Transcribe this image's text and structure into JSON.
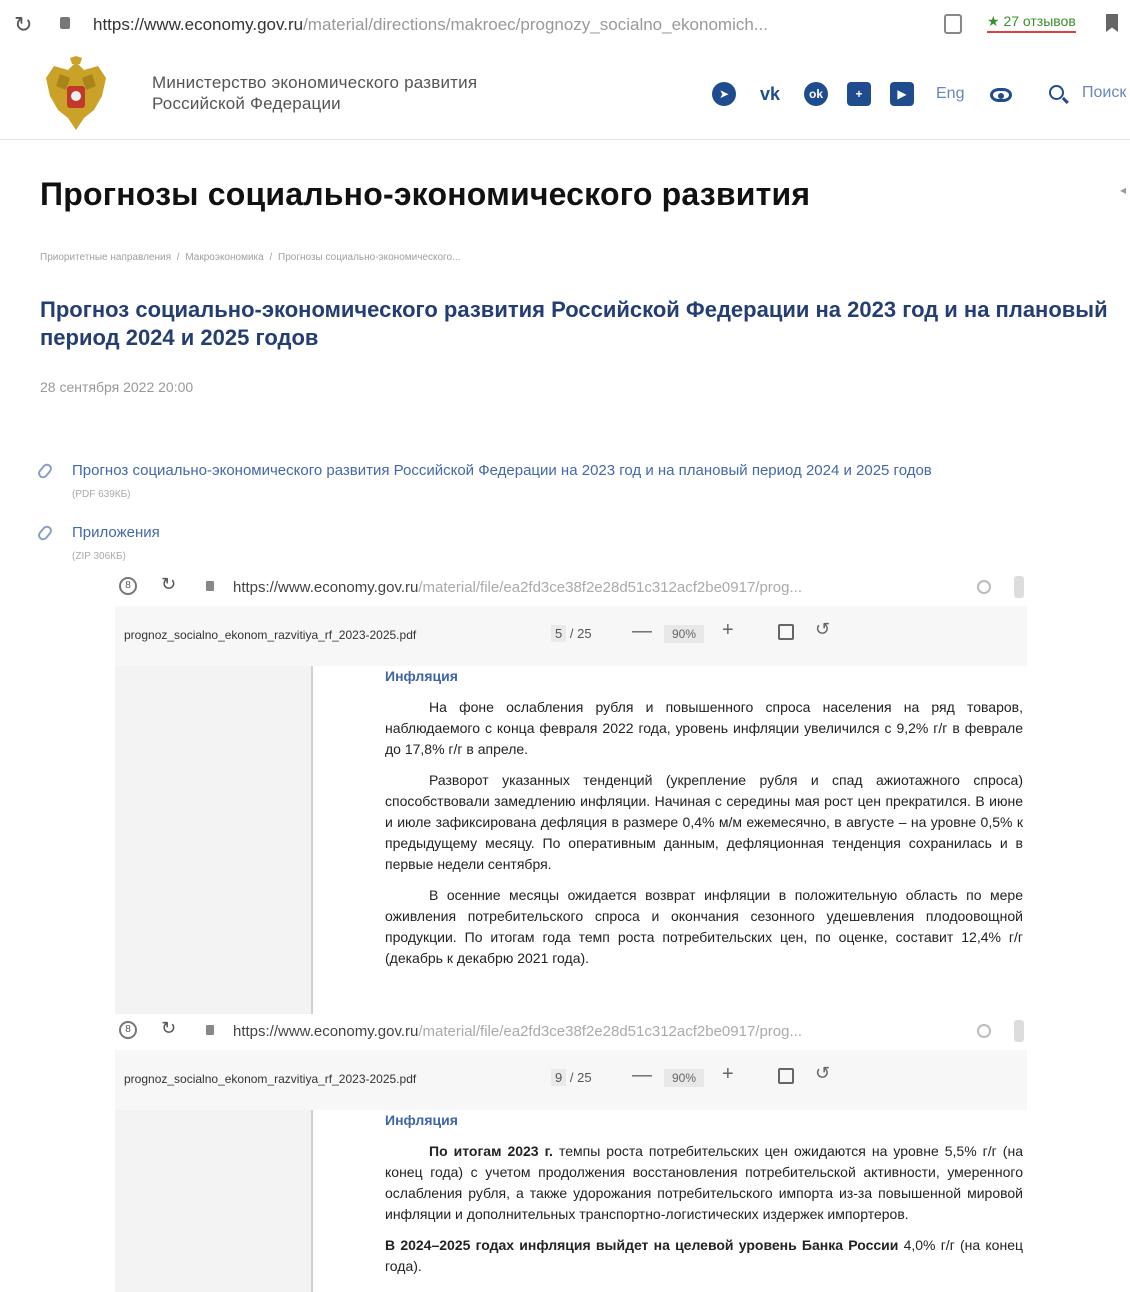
{
  "browser": {
    "url_host": "https://www.economy.gov.ru",
    "url_path": "/material/directions/makroec/prognozy_socialno_ekonomich...",
    "reviews": "★ 27 отзывов"
  },
  "header": {
    "ministry_line1": "Министерство экономического развития",
    "ministry_line2": "Российской Федерации",
    "social": [
      "telegram-icon",
      "vk-icon",
      "odnoklassniki-icon",
      "plus-icon",
      "youtube-icon"
    ],
    "lang": "Eng",
    "search_label": "Поиск"
  },
  "page": {
    "title": "Прогнозы социально-экономического развития",
    "breadcrumb": [
      "Приоритетные направления",
      "/",
      "Макроэкономика",
      "/",
      "Прогнозы социально-экономического..."
    ],
    "doc_title": "Прогноз социально-экономического развития Российской Федерации на 2023 год и на плановый период 2024 и 2025 годов",
    "date": "28 сентября 2022 20:00",
    "attachments": [
      {
        "name": "Прогноз социально-экономического развития Российской Федерации на 2023 год и на плановый период 2024 и 2025 годов",
        "meta": "(PDF 639КБ)"
      },
      {
        "name": "Приложения",
        "meta": "(ZIP 306КБ)"
      }
    ]
  },
  "pdf1": {
    "url_host": "https://www.economy.gov.ru",
    "url_path": "/material/file/ea2fd3ce38f2e28d51c312acf2be0917/prog...",
    "filename": "prognoz_socialno_ekonom_razvitiya_rf_2023-2025.pdf",
    "page_current": "5",
    "page_total": "/ 25",
    "zoom": "90%",
    "heading": "Инфляция",
    "paragraphs": [
      "На фоне ослабления рубля и повышенного спроса населения на ряд товаров, наблюдаемого с конца февраля 2022 года, уровень инфляции увеличился с 9,2% г/г в феврале до 17,8% г/г в апреле.",
      "Разворот указанных тенденций (укрепление рубля и спад ажиотажного спроса) способствовали замедлению инфляции. Начиная с середины мая рост цен прекратился. В июне и июле зафиксирована дефляция в размере 0,4% м/м ежемесячно, в августе – на уровне 0,5% к предыдущему месяцу. По оперативным данным, дефляционная тенденция сохранилась и в первые недели сентября.",
      "В осенние месяцы ожидается возврат инфляции в положительную область по мере оживления потребительского спроса и окончания сезонного удешевления плодоовощной продукции. По итогам года темп роста потребительских цен, по оценке, составит 12,4% г/г (декабрь к декабрю 2021 года)."
    ]
  },
  "pdf2": {
    "url_host": "https://www.economy.gov.ru",
    "url_path": "/material/file/ea2fd3ce38f2e28d51c312acf2be0917/prog...",
    "filename": "prognoz_socialno_ekonom_razvitiya_rf_2023-2025.pdf",
    "page_current": "9",
    "page_total": "/ 25",
    "zoom": "90%",
    "heading": "Инфляция",
    "p1_bold": "По итогам 2023 г.",
    "p1_rest": " темпы роста потребительских цен ожидаются на уровне 5,5% г/г (на конец года) с учетом продолжения восстановления потребительской активности, умеренного ослабления рубля, а также удорожания потребительского импорта из-за повышенной мировой инфляции и дополнительных транспортно-логистических издержек импортеров.",
    "p2_bold": "В 2024–2025 годах инфляция выйдет на целевой уровень Банка России",
    "p2_rest": " 4,0% г/г (на конец года)."
  }
}
